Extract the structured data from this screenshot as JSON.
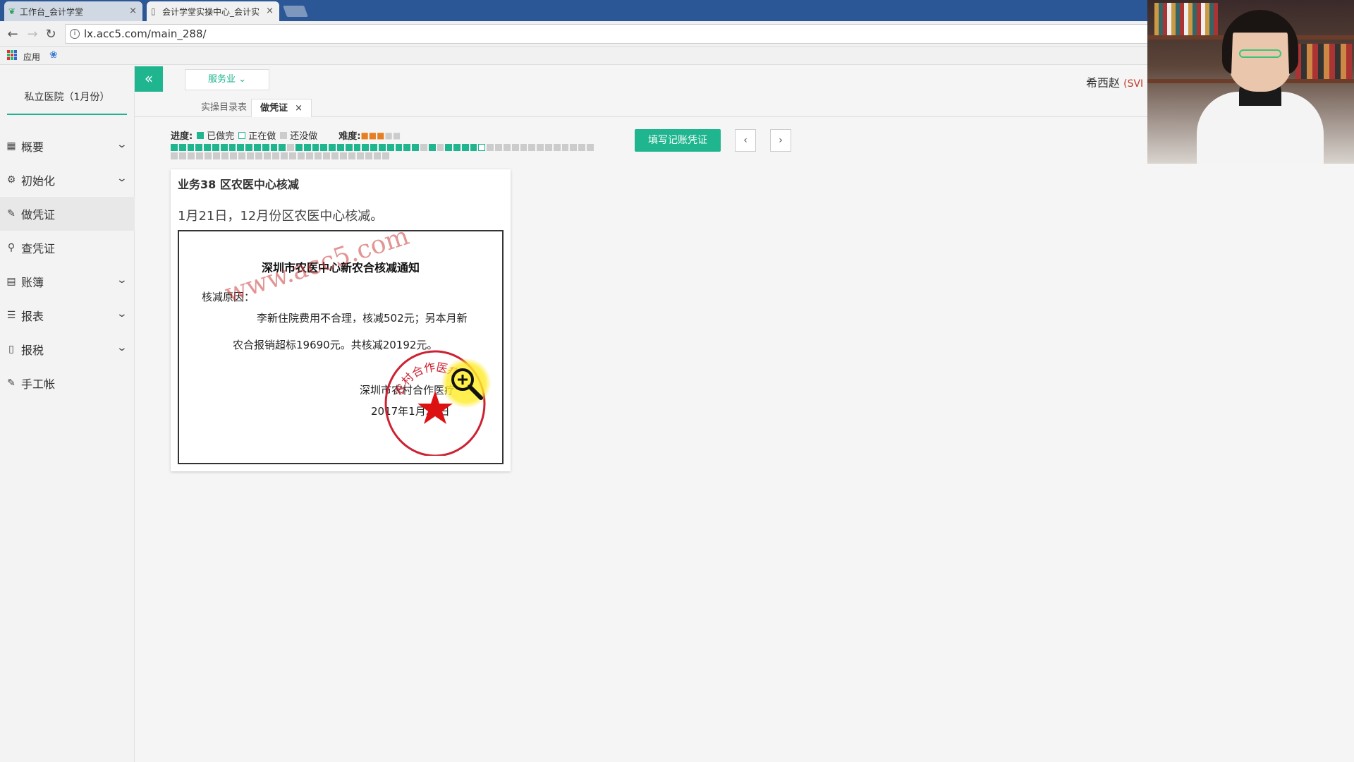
{
  "browser": {
    "tabs": [
      {
        "title": "工作台_会计学堂",
        "favicon": "leaf-icon"
      },
      {
        "title": "会计学堂实操中心_会计实",
        "favicon": "page-icon"
      }
    ],
    "url": "lx.acc5.com/main_288/",
    "bookmarks": {
      "apps_label": "应用"
    }
  },
  "sidebar": {
    "company": "私立医院（1月份）",
    "items": [
      {
        "label": "概要",
        "icon": "grid-icon",
        "expandable": true
      },
      {
        "label": "初始化",
        "icon": "gear-icon",
        "expandable": true
      },
      {
        "label": "做凭证",
        "icon": "pen-icon",
        "expandable": false,
        "active": true
      },
      {
        "label": "查凭证",
        "icon": "search-icon",
        "expandable": false
      },
      {
        "label": "账簿",
        "icon": "book-icon",
        "expandable": true
      },
      {
        "label": "报表",
        "icon": "table-icon",
        "expandable": true
      },
      {
        "label": "报税",
        "icon": "file-icon",
        "expandable": true
      },
      {
        "label": "手工帐",
        "icon": "pen-icon",
        "expandable": false
      }
    ]
  },
  "header": {
    "industry": "服务业",
    "user": "希西赵",
    "user_suffix": "(SVI"
  },
  "page_tabs": {
    "t1": "实操目录表",
    "t2": "做凭证"
  },
  "progress": {
    "label": "进度:",
    "done_label": "已做完",
    "doing_label": "正在做",
    "todo_label": "还没做",
    "difficulty_label": "难度:",
    "difficulty": 3,
    "difficulty_max": 5,
    "cells_row1": "dddddddddddddd1ddddddddddddddd1d1ddddp1111111111111",
    "cells_row2": "11111111111111111111111111"
  },
  "actions": {
    "fill_voucher": "填写记账凭证",
    "prev": "‹",
    "next": "›"
  },
  "business": {
    "title": "业务38 区农医中心核减",
    "description": "1月21日，12月份区农医中心核减。",
    "document": {
      "title": "深圳市农医中心新农合核减通知",
      "reason_label": "核减原因：",
      "body_line1": "李新住院费用不合理，核减502元；另本月新",
      "body_line2": "农合报销超标19690元。共核减20192元。",
      "signature": "深圳市农村合作医疗",
      "date": "2017年1月21日",
      "watermark": "www.acc5.com",
      "stamp_text": "农村合作医疗"
    }
  },
  "colors": {
    "accent": "#1fb58f",
    "tabbar": "#2b5797",
    "stamp": "#cc2233"
  }
}
